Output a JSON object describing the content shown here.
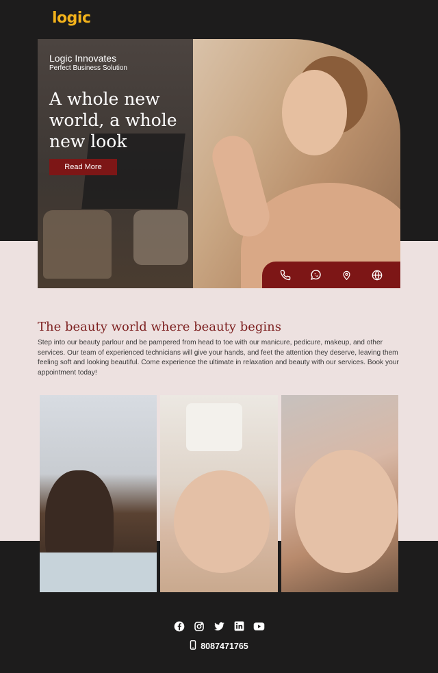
{
  "logo": {
    "text": "logic",
    "sub": ""
  },
  "hero": {
    "brand": "Logic Innovates",
    "tagline": "Perfect Business Solution",
    "headline": "A whole new world, a whole new look",
    "cta_label": "Read More",
    "contact_icons": [
      "phone-icon",
      "whatsapp-icon",
      "location-pin-icon",
      "globe-icon"
    ]
  },
  "about": {
    "title": "The beauty world where beauty begins",
    "body": "Step into our beauty parlour and be pampered from head to toe with our manicure, pedicure, makeup, and other services. Our team of experienced technicians will give your hands, and feet the attention they deserve, leaving them feeling soft and looking beautiful. Come experience the ultimate in relaxation and beauty with our services. Book your appointment today!"
  },
  "gallery": [
    "hair-styling-photo",
    "manicure-photo",
    "eyelash-extension-photo"
  ],
  "footer": {
    "social_icons": [
      "facebook-icon",
      "instagram-icon",
      "twitter-icon",
      "linkedin-icon",
      "youtube-icon"
    ],
    "phone": "8087471765"
  },
  "colors": {
    "accent": "#7d1616",
    "dark": "#1d1c1c",
    "band": "#ede1e0",
    "logo": "#f3b21b"
  }
}
